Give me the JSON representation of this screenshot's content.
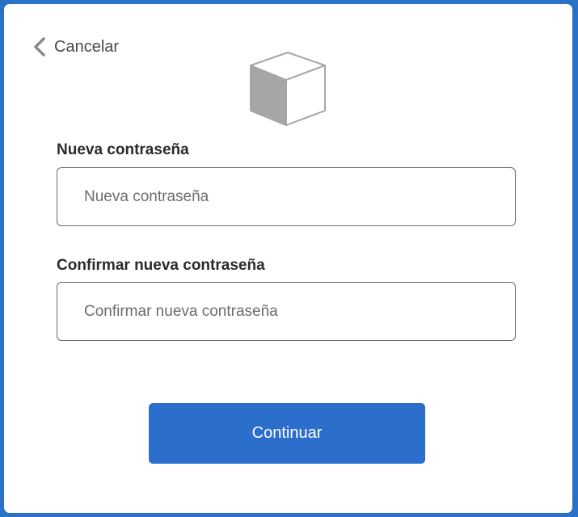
{
  "header": {
    "cancel_label": "Cancelar",
    "back_icon": "chevron-left-icon",
    "logo_icon": "cube-icon"
  },
  "form": {
    "new_password": {
      "label": "Nueva contraseña",
      "placeholder": "Nueva contraseña",
      "value": ""
    },
    "confirm_password": {
      "label": "Confirmar nueva contraseña",
      "placeholder": "Confirmar nueva contraseña",
      "value": ""
    },
    "continue_label": "Continuar"
  },
  "colors": {
    "accent": "#2b6ecb",
    "frame": "#2a72c8",
    "text": "#2b2b2b",
    "placeholder": "#6d6d6d"
  }
}
